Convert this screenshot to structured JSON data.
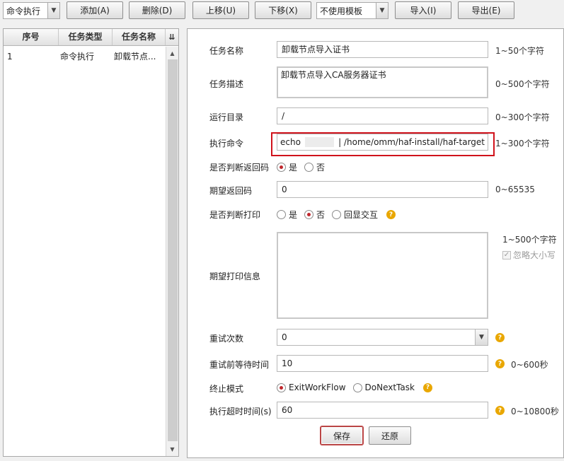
{
  "toolbar": {
    "task_type_select": "命令执行",
    "add_label": "添加(A)",
    "delete_label": "删除(D)",
    "move_up_label": "上移(U)",
    "move_down_label": "下移(X)",
    "template_select": "不使用模板",
    "import_label": "导入(I)",
    "export_label": "导出(E)"
  },
  "task_list": {
    "headers": [
      "序号",
      "任务类型",
      "任务名称"
    ],
    "rows": [
      {
        "index": "1",
        "type": "命令执行",
        "name": "卸载节点..."
      }
    ]
  },
  "form": {
    "task_name": {
      "label": "任务名称",
      "value": "卸载节点导入证书",
      "hint": "1~50个字符"
    },
    "task_desc": {
      "label": "任务描述",
      "value": "卸载节点导入CA服务器证书",
      "hint": "0~500个字符"
    },
    "run_dir": {
      "label": "运行目录",
      "value": "/",
      "hint": "0~300个字符"
    },
    "exec_cmd": {
      "label": "执行命令",
      "value_prefix": "echo",
      "value_suffix": "| /home/omm/haf-install/haf-target",
      "hint": "1~300个字符"
    },
    "check_return": {
      "label": "是否判断返回码",
      "options": [
        "是",
        "否"
      ],
      "selected": "是"
    },
    "expected_return": {
      "label": "期望返回码",
      "value": "0",
      "hint": "0~65535"
    },
    "check_print": {
      "label": "是否判断打印",
      "options": [
        "是",
        "否",
        "回显交互"
      ],
      "selected": "否"
    },
    "expected_print": {
      "label": "期望打印信息",
      "value": "",
      "hint": "1~500个字符",
      "ignore_case_label": "忽略大小写",
      "ignore_case_checked": true
    },
    "retry_count": {
      "label": "重试次数",
      "value": "0"
    },
    "retry_wait": {
      "label": "重试前等待时间",
      "value": "10",
      "hint": "0~600秒"
    },
    "stop_mode": {
      "label": "终止模式",
      "options": [
        "ExitWorkFlow",
        "DoNextTask"
      ],
      "selected": "ExitWorkFlow"
    },
    "exec_timeout": {
      "label": "执行超时时间(s)",
      "value": "60",
      "hint": "0~10800秒"
    }
  },
  "footer": {
    "save_label": "保存",
    "restore_label": "还原"
  },
  "colors": {
    "highlight_border": "#d0121b",
    "radio_checked": "#c0272d",
    "help_icon": "#e9a700"
  }
}
